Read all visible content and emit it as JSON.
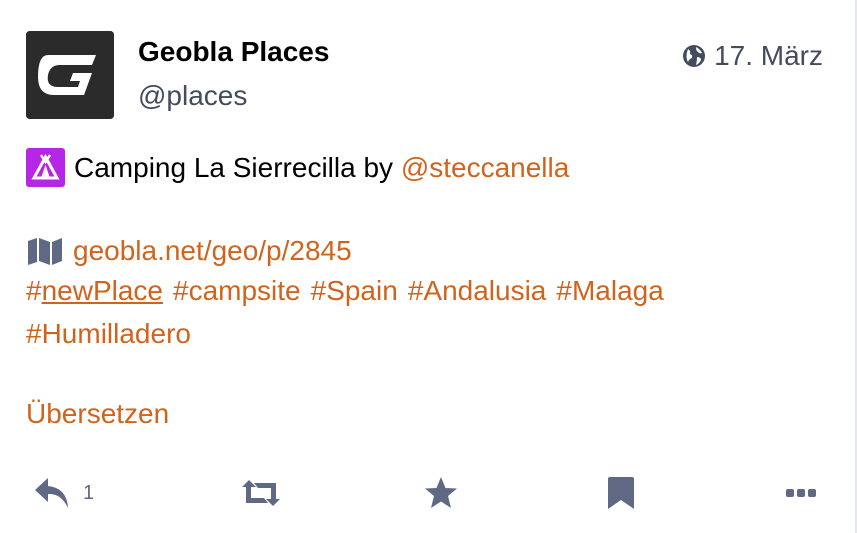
{
  "status": {
    "author": {
      "display_name": "Geobla Places",
      "username": "@places",
      "avatar_icon": "geobla-g-logo"
    },
    "timestamp": "17. März",
    "visibility_icon": "globe-icon",
    "content": {
      "emoji_icon": "tent-emoji",
      "title_text": "Camping La Sierrecilla by ",
      "mention": "@steccanella",
      "map_icon": "map-icon",
      "link": "geobla.net/geo/p/2845",
      "hashtags_line1": [
        {
          "hash": "#",
          "name": "newPlace",
          "underline": true
        },
        {
          "hash": "#",
          "name": "campsite"
        },
        {
          "hash": "#",
          "name": "Spain"
        },
        {
          "hash": "#",
          "name": "Andalusia"
        },
        {
          "hash": "#",
          "name": "Malaga"
        }
      ],
      "hashtags_line2": [
        {
          "hash": "#",
          "name": "Humilladero"
        }
      ]
    },
    "translate_label": "Übersetzen",
    "actions": {
      "reply_count": "1"
    }
  },
  "colors": {
    "link": "#d0641d",
    "icon": "#606984",
    "emoji_bg": "#b526e6",
    "text": "#000000",
    "muted": "#444b5d"
  }
}
